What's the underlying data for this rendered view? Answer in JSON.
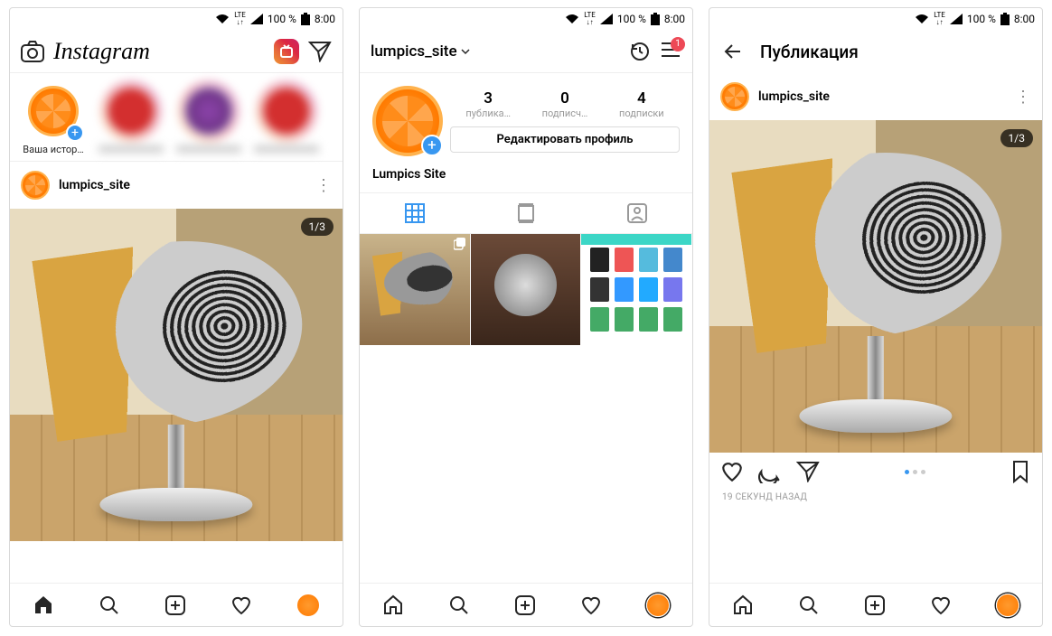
{
  "status": {
    "lte": "LTE",
    "battery": "100 %",
    "time": "8:00"
  },
  "feed": {
    "logo": "Instagram",
    "your_story": "Ваша истор…",
    "post_user": "lumpics_site",
    "carousel": "1/3"
  },
  "profile": {
    "username": "lumpics_site",
    "badge": "1",
    "stats": {
      "posts_n": "3",
      "posts_l": "публика…",
      "followers_n": "0",
      "followers_l": "подписч…",
      "following_n": "4",
      "following_l": "подписки"
    },
    "edit": "Редактировать профиль",
    "display_name": "Lumpics Site"
  },
  "publication": {
    "title": "Публикация",
    "user": "lumpics_site",
    "carousel": "1/3",
    "timestamp": "19 СЕКУНД НАЗАД"
  }
}
